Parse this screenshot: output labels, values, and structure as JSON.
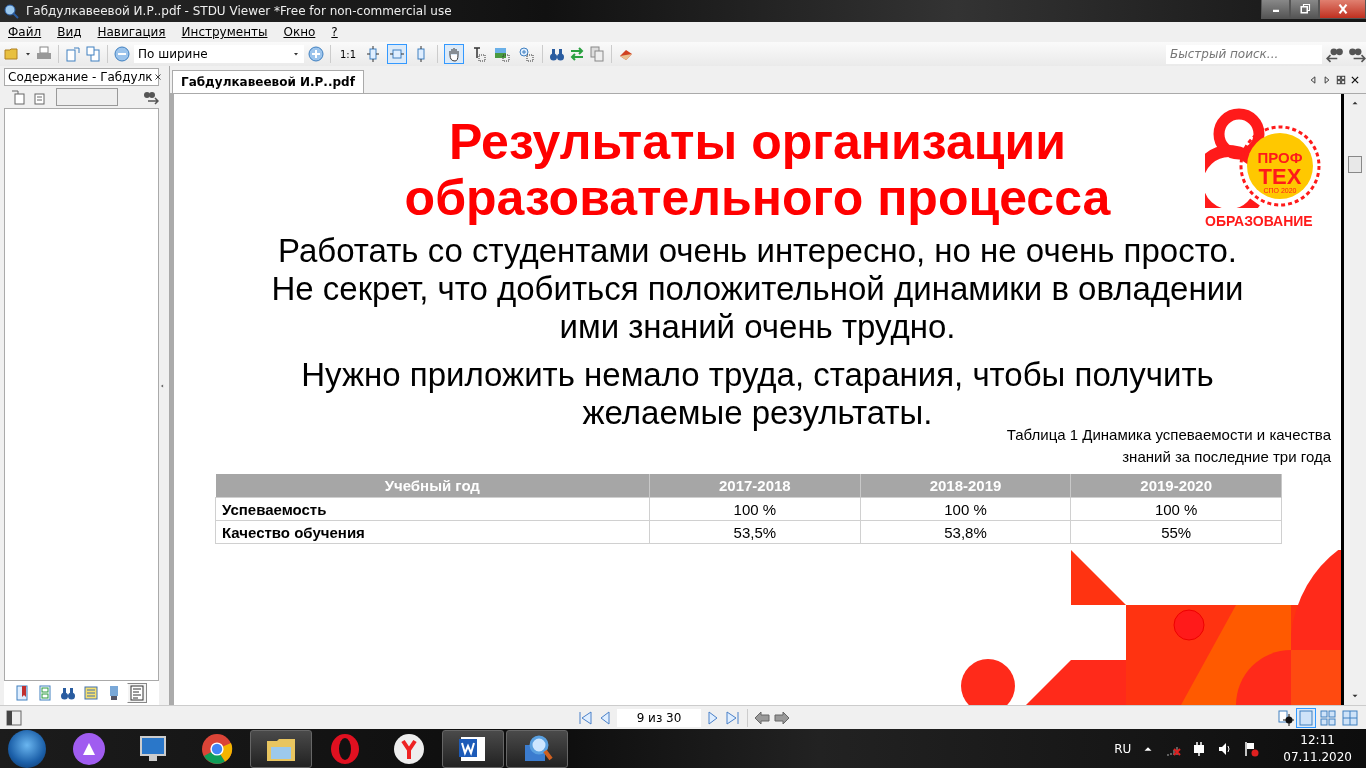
{
  "window": {
    "title": "Габдулкавеевой И.Р..pdf - STDU Viewer *Free for non-commercial use"
  },
  "menu": [
    "Файл",
    "Вид",
    "Навигация",
    "Инструменты",
    "Окно",
    "?"
  ],
  "toolbar": {
    "zoom_select": "По ширине",
    "actual_size": "1:1",
    "fit_modes": [
      {
        "selected": false
      },
      {
        "selected": true
      },
      {
        "selected": false
      }
    ],
    "tools": [
      {
        "selected": true
      },
      {
        "selected": false
      },
      {
        "selected": false
      },
      {
        "selected": false
      }
    ],
    "quick_search": {
      "placeholder": "Быстрый поиск..."
    }
  },
  "side_panel": {
    "title": "Содержание - Габдулк",
    "tabs": [
      {
        "selected": false
      },
      {
        "selected": false
      },
      {
        "selected": false
      },
      {
        "selected": false
      },
      {
        "selected": false
      },
      {
        "selected": true
      }
    ]
  },
  "document_tab": {
    "label": "Габдулкавеевой И.Р..pdf"
  },
  "slide": {
    "title": "Результаты организации образовательного процесса",
    "logo": {
      "top": "ПРОФ",
      "middle": "ТЕХ",
      "ring": "СПО 2020",
      "bottom": "ОБРАЗОВАНИЕ"
    },
    "paragraphs": [
      "Работать со студентами очень интересно, но не очень просто. Не секрет, что добиться положительной динамики в овладении ими знаний очень трудно.",
      "Нужно приложить немало труда, старания, чтобы получить желаемые результаты."
    ],
    "caption": "Таблица 1 Динамика успеваемости и качества знаний за последние три года",
    "table": {
      "columns": [
        "Учебный год",
        "2017-2018",
        "2018-2019",
        "2019-2020"
      ],
      "rows": [
        [
          "Успеваемость",
          "100 %",
          "100 %",
          "100 %"
        ],
        [
          "Качество обучения",
          "53,5%",
          "53,8%",
          "55%"
        ]
      ]
    }
  },
  "status_bar": {
    "page": "9 из 30",
    "layouts": [
      {
        "selected": true
      },
      {
        "selected": false
      },
      {
        "selected": false
      }
    ]
  },
  "taskbar": {
    "apps": [
      {
        "kind": "assistant",
        "running": false
      },
      {
        "kind": "computer",
        "running": false
      },
      {
        "kind": "chrome",
        "running": false
      },
      {
        "kind": "folder",
        "running": true
      },
      {
        "kind": "opera",
        "running": false
      },
      {
        "kind": "yandex",
        "running": false
      },
      {
        "kind": "word",
        "running": true
      },
      {
        "kind": "viewer",
        "running": true
      }
    ],
    "language": "RU",
    "time": "12:11",
    "date": "07.11.2020"
  }
}
